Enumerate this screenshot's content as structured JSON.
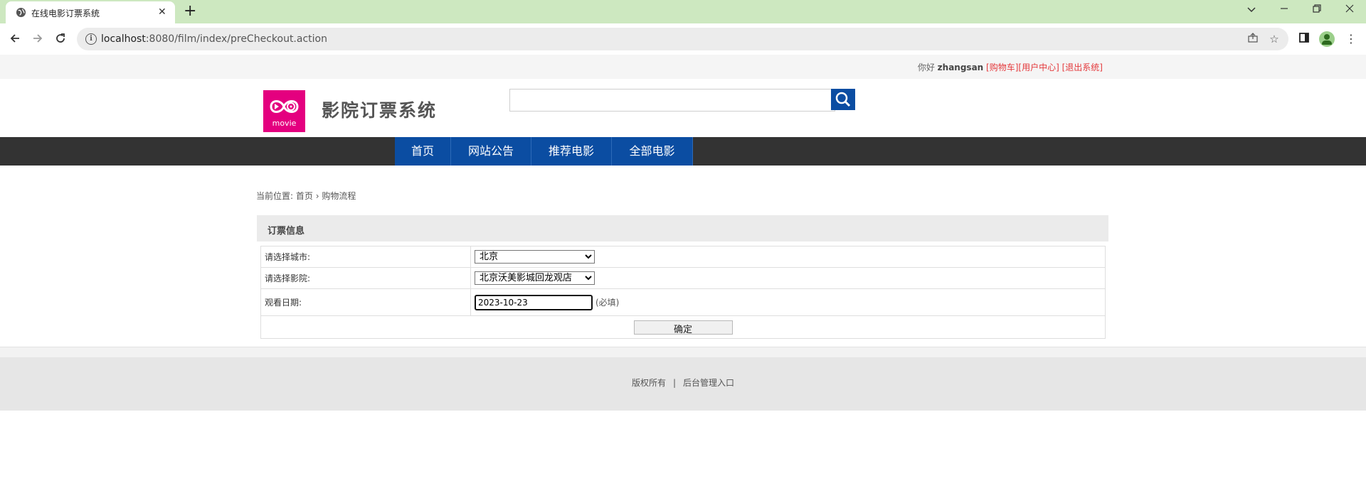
{
  "browser": {
    "tab_title": "在线电影订票系统",
    "tab_close": "✕",
    "new_tab": "+",
    "url_host": "localhost",
    "url_rest": ":8080/film/index/preCheckout.action",
    "icons": [
      "back-icon",
      "forward-icon",
      "reload-icon",
      "site-info-icon",
      "share-icon",
      "bookmark-star-icon",
      "side-panel-icon",
      "profile-avatar-icon",
      "menu-icon",
      "minimize-icon",
      "maximize-icon",
      "close-icon",
      "tab-list-icon"
    ]
  },
  "topbar": {
    "greeting": "你好",
    "username": "zhangsan",
    "cart_link": "[购物车]",
    "user_center_link": "[用户中心]",
    "logout_link": "[退出系统]"
  },
  "header": {
    "logo_text": "movie",
    "site_title": "影院订票系统",
    "search_placeholder": ""
  },
  "nav": {
    "items": [
      "首页",
      "网站公告",
      "推荐电影",
      "全部电影"
    ]
  },
  "breadcrumb": {
    "prefix": "当前位置:",
    "home": "首页",
    "separator": "›",
    "current": "购物流程"
  },
  "order_panel": {
    "title": "订票信息",
    "city_label": "请选择城市:",
    "city_value": "北京",
    "cinema_label": "请选择影院:",
    "cinema_value": "北京沃美影城回龙观店",
    "date_label": "观看日期:",
    "date_value": "2023-10-23",
    "required_note": "(必填)",
    "submit_label": "确定"
  },
  "footer": {
    "copyright": "版权所有",
    "divider": "|",
    "admin_link": "后台管理入口"
  },
  "colors": {
    "tabstrip": "#cde8c0",
    "nav_blue": "#0b4da2",
    "nav_dark": "#333333",
    "logo_pink": "#e4007f",
    "link_red": "#e4393c"
  }
}
